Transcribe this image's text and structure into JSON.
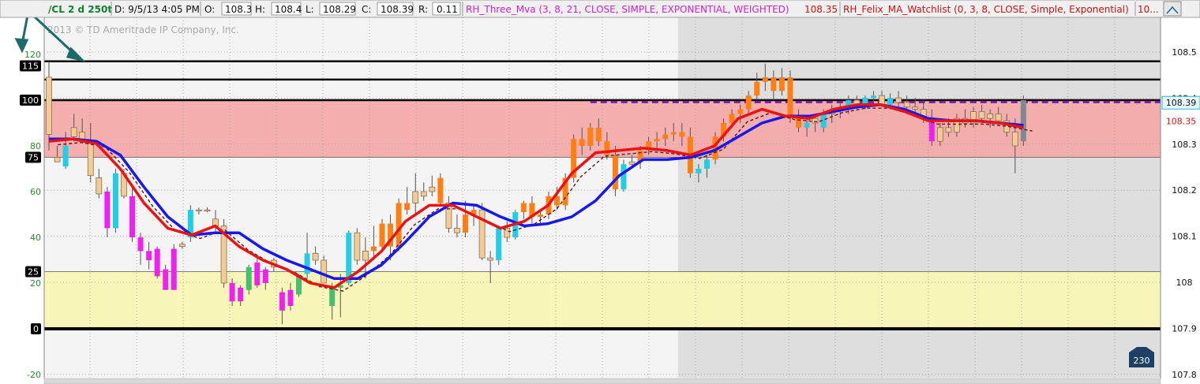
{
  "header": {
    "symbol": "/CL 2 d 250t",
    "date_field": "D: 9/5/13 4:05 PM",
    "open_label": "O:",
    "open_value": "108.3",
    "high_label": "H:",
    "high_value": "108.4",
    "low_label": "L:",
    "low_value": "108.29",
    "close_label": "C:",
    "close_value": "108.39",
    "range_label": "R:",
    "range_value": "0.11",
    "study1_name": "RH_Three_Mva (3, 8, 21, CLOSE, SIMPLE, EXPONENTIAL, WEIGHTED)",
    "study1_value": "108.35",
    "study2_name": "RH_Felix_MA_Watchlist (0, 3, 8, CLOSE, Simple, Exponential)",
    "study2_value": "10..."
  },
  "copyright": "2013 © TD Ameritrade IP Company, Inc.",
  "badge": "230",
  "colors": {
    "background": "#f4f4f4",
    "shaded_region": "#dedede",
    "red_zone": "#f4a8a8",
    "yellow_zone": "#f8f6b4",
    "candle_orange": "#ff7f14",
    "candle_cyan": "#22cde6",
    "candle_magenta": "#ee22ee",
    "candle_green": "#46c070",
    "candle_tan": "#f2cc96",
    "fast_ma": "#ee1111",
    "slow_ma_up": "#1818ee",
    "slow_ma_down": "#7a1aa6",
    "header_symbol": "#108030",
    "study1": "#cc22cc",
    "study2": "#cc1111"
  },
  "chart_data": {
    "type": "candlestick",
    "left_axis": {
      "ticks": [
        "-20",
        "0",
        "20",
        "25",
        "40",
        "60",
        "75",
        "80",
        "100",
        "115",
        "120"
      ],
      "range": [
        -20,
        125
      ],
      "boxed_ticks": [
        "0",
        "25",
        "75",
        "100",
        "115"
      ]
    },
    "right_axis": {
      "ticks": [
        "107.8",
        "107.9",
        "108",
        "108.1",
        "108.2",
        "108.3",
        "108.4",
        "108.5"
      ],
      "range": [
        107.795,
        108.555
      ]
    },
    "price_tags": [
      {
        "label": "108.39",
        "value": 108.39,
        "style": "cyan"
      },
      {
        "label": "108.35",
        "value": 108.35,
        "style": "red"
      }
    ],
    "horizontal_levels": [
      {
        "name": "level-0",
        "value": 0
      },
      {
        "name": "level-100",
        "value": 100
      },
      {
        "name": "level-upper-1",
        "value": 109
      },
      {
        "name": "level-upper-2",
        "value": 117
      }
    ],
    "zones": [
      {
        "name": "overbought-zone",
        "from": 75,
        "to": 100,
        "color": "red_zone"
      },
      {
        "name": "oversold-zone",
        "from": 0,
        "to": 25,
        "color": "yellow_zone"
      }
    ],
    "dashed_level": {
      "value": 99.2,
      "start_index": 65
    },
    "shaded_from_index": 76,
    "candles": [
      {
        "o": 110,
        "h": 117,
        "l": 78,
        "c": 85,
        "k": "tan"
      },
      {
        "o": 75,
        "h": 80,
        "l": 73,
        "c": 73,
        "k": "tan"
      },
      {
        "o": 80,
        "h": 86,
        "l": 70,
        "c": 71,
        "k": "cyan"
      },
      {
        "o": 88,
        "h": 94,
        "l": 82,
        "c": 84,
        "k": "tan"
      },
      {
        "o": 86,
        "h": 92,
        "l": 82,
        "c": 82,
        "k": "tan"
      },
      {
        "o": 81,
        "h": 90,
        "l": 64,
        "c": 67,
        "k": "tan"
      },
      {
        "o": 66,
        "h": 70,
        "l": 57,
        "c": 59,
        "k": "tan"
      },
      {
        "o": 60,
        "h": 62,
        "l": 40,
        "c": 44,
        "k": "magenta"
      },
      {
        "o": 44,
        "h": 70,
        "l": 42,
        "c": 68,
        "k": "cyan"
      },
      {
        "o": 68,
        "h": 70,
        "l": 57,
        "c": 58,
        "k": "tan"
      },
      {
        "o": 58,
        "h": 62,
        "l": 38,
        "c": 40,
        "k": "magenta"
      },
      {
        "o": 40,
        "h": 42,
        "l": 28,
        "c": 34,
        "k": "magenta"
      },
      {
        "o": 34,
        "h": 38,
        "l": 26,
        "c": 30,
        "k": "magenta"
      },
      {
        "o": 35,
        "h": 36,
        "l": 22,
        "c": 23,
        "k": "magenta"
      },
      {
        "o": 26,
        "h": 28,
        "l": 17,
        "c": 17,
        "k": "magenta"
      },
      {
        "o": 35,
        "h": 37,
        "l": 17,
        "c": 17,
        "k": "magenta"
      },
      {
        "o": 36,
        "h": 38,
        "l": 35,
        "c": 37,
        "k": "tan"
      },
      {
        "o": 40,
        "h": 54,
        "l": 38,
        "c": 52,
        "k": "cyan"
      },
      {
        "o": 52,
        "h": 53,
        "l": 50,
        "c": 52,
        "k": "tan"
      },
      {
        "o": 52,
        "h": 53,
        "l": 51,
        "c": 52,
        "k": "tan"
      },
      {
        "o": 48,
        "h": 52,
        "l": 42,
        "c": 45,
        "k": "tan"
      },
      {
        "o": 45,
        "h": 48,
        "l": 18,
        "c": 20,
        "k": "tan"
      },
      {
        "o": 20,
        "h": 22,
        "l": 10,
        "c": 12,
        "k": "magenta"
      },
      {
        "o": 18,
        "h": 19,
        "l": 10,
        "c": 12,
        "k": "magenta"
      },
      {
        "o": 17,
        "h": 28,
        "l": 15,
        "c": 27,
        "k": "green"
      },
      {
        "o": 19,
        "h": 31,
        "l": 18,
        "c": 29,
        "k": "magenta"
      },
      {
        "o": 20,
        "h": 27,
        "l": 17,
        "c": 26,
        "k": "magenta"
      },
      {
        "o": 30,
        "h": 31,
        "l": 25,
        "c": 27,
        "k": "tan"
      },
      {
        "o": 16,
        "h": 18,
        "l": 2,
        "c": 8,
        "k": "magenta"
      },
      {
        "o": 17,
        "h": 20,
        "l": 8,
        "c": 10,
        "k": "magenta"
      },
      {
        "o": 15,
        "h": 24,
        "l": 14,
        "c": 23,
        "k": "green"
      },
      {
        "o": 24,
        "h": 42,
        "l": 22,
        "c": 33,
        "k": "cyan"
      },
      {
        "o": 33,
        "h": 36,
        "l": 28,
        "c": 30,
        "k": "tan"
      },
      {
        "o": 30,
        "h": 32,
        "l": 24,
        "c": 20,
        "k": "tan"
      },
      {
        "o": 10,
        "h": 20,
        "l": 4,
        "c": 18,
        "k": "green"
      },
      {
        "o": 18,
        "h": 24,
        "l": 5,
        "c": 19,
        "k": "green"
      },
      {
        "o": 20,
        "h": 43,
        "l": 19,
        "c": 42,
        "k": "cyan"
      },
      {
        "o": 42,
        "h": 44,
        "l": 28,
        "c": 30,
        "k": "tan"
      },
      {
        "o": 30,
        "h": 40,
        "l": 22,
        "c": 34,
        "k": "tan"
      },
      {
        "o": 34,
        "h": 45,
        "l": 30,
        "c": 36,
        "k": "orange"
      },
      {
        "o": 36,
        "h": 48,
        "l": 34,
        "c": 46,
        "k": "orange"
      },
      {
        "o": 46,
        "h": 50,
        "l": 30,
        "c": 36,
        "k": "orange"
      },
      {
        "o": 36,
        "h": 57,
        "l": 34,
        "c": 55,
        "k": "orange"
      },
      {
        "o": 55,
        "h": 62,
        "l": 50,
        "c": 52,
        "k": "orange"
      },
      {
        "o": 55,
        "h": 68,
        "l": 50,
        "c": 60,
        "k": "tan"
      },
      {
        "o": 60,
        "h": 64,
        "l": 56,
        "c": 58,
        "k": "tan"
      },
      {
        "o": 62,
        "h": 67,
        "l": 58,
        "c": 60,
        "k": "tan"
      },
      {
        "o": 66,
        "h": 68,
        "l": 54,
        "c": 55,
        "k": "orange"
      },
      {
        "o": 55,
        "h": 58,
        "l": 42,
        "c": 44,
        "k": "tan"
      },
      {
        "o": 44,
        "h": 50,
        "l": 40,
        "c": 42,
        "k": "tan"
      },
      {
        "o": 42,
        "h": 56,
        "l": 40,
        "c": 50,
        "k": "orange"
      },
      {
        "o": 50,
        "h": 54,
        "l": 45,
        "c": 52,
        "k": "orange"
      },
      {
        "o": 52,
        "h": 55,
        "l": 30,
        "c": 31,
        "k": "tan"
      },
      {
        "o": 31,
        "h": 34,
        "l": 20,
        "c": 30,
        "k": "tan"
      },
      {
        "o": 30,
        "h": 45,
        "l": 28,
        "c": 44,
        "k": "cyan"
      },
      {
        "o": 44,
        "h": 47,
        "l": 38,
        "c": 40,
        "k": "tan"
      },
      {
        "o": 40,
        "h": 52,
        "l": 39,
        "c": 51,
        "k": "cyan"
      },
      {
        "o": 51,
        "h": 56,
        "l": 48,
        "c": 55,
        "k": "orange"
      },
      {
        "o": 55,
        "h": 58,
        "l": 46,
        "c": 49,
        "k": "orange"
      },
      {
        "o": 49,
        "h": 52,
        "l": 45,
        "c": 50,
        "k": "orange"
      },
      {
        "o": 50,
        "h": 60,
        "l": 48,
        "c": 58,
        "k": "orange"
      },
      {
        "o": 58,
        "h": 62,
        "l": 52,
        "c": 54,
        "k": "orange"
      },
      {
        "o": 54,
        "h": 68,
        "l": 52,
        "c": 66,
        "k": "orange"
      },
      {
        "o": 66,
        "h": 85,
        "l": 64,
        "c": 83,
        "k": "orange"
      },
      {
        "o": 83,
        "h": 88,
        "l": 76,
        "c": 80,
        "k": "orange"
      },
      {
        "o": 80,
        "h": 90,
        "l": 78,
        "c": 88,
        "k": "orange"
      },
      {
        "o": 88,
        "h": 92,
        "l": 80,
        "c": 82,
        "k": "orange"
      },
      {
        "o": 82,
        "h": 86,
        "l": 74,
        "c": 76,
        "k": "orange"
      },
      {
        "o": 76,
        "h": 80,
        "l": 58,
        "c": 61,
        "k": "orange"
      },
      {
        "o": 61,
        "h": 74,
        "l": 60,
        "c": 72,
        "k": "cyan"
      },
      {
        "o": 72,
        "h": 76,
        "l": 70,
        "c": 73,
        "k": "tan"
      },
      {
        "o": 73,
        "h": 80,
        "l": 70,
        "c": 78,
        "k": "orange"
      },
      {
        "o": 78,
        "h": 84,
        "l": 76,
        "c": 82,
        "k": "orange"
      },
      {
        "o": 82,
        "h": 86,
        "l": 78,
        "c": 83,
        "k": "orange"
      },
      {
        "o": 83,
        "h": 88,
        "l": 80,
        "c": 85,
        "k": "orange"
      },
      {
        "o": 85,
        "h": 90,
        "l": 82,
        "c": 86,
        "k": "orange"
      },
      {
        "o": 86,
        "h": 90,
        "l": 80,
        "c": 84,
        "k": "orange"
      },
      {
        "o": 84,
        "h": 88,
        "l": 66,
        "c": 68,
        "k": "orange"
      },
      {
        "o": 68,
        "h": 72,
        "l": 64,
        "c": 70,
        "k": "cyan"
      },
      {
        "o": 70,
        "h": 76,
        "l": 66,
        "c": 74,
        "k": "cyan"
      },
      {
        "o": 74,
        "h": 86,
        "l": 72,
        "c": 84,
        "k": "orange"
      },
      {
        "o": 84,
        "h": 92,
        "l": 82,
        "c": 90,
        "k": "orange"
      },
      {
        "o": 90,
        "h": 96,
        "l": 88,
        "c": 94,
        "k": "orange"
      },
      {
        "o": 94,
        "h": 98,
        "l": 90,
        "c": 96,
        "k": "orange"
      },
      {
        "o": 96,
        "h": 104,
        "l": 94,
        "c": 102,
        "k": "orange"
      },
      {
        "o": 102,
        "h": 112,
        "l": 100,
        "c": 108,
        "k": "orange"
      },
      {
        "o": 108,
        "h": 116,
        "l": 104,
        "c": 110,
        "k": "orange"
      },
      {
        "o": 110,
        "h": 113,
        "l": 100,
        "c": 104,
        "k": "orange"
      },
      {
        "o": 104,
        "h": 114,
        "l": 102,
        "c": 110,
        "k": "orange"
      },
      {
        "o": 110,
        "h": 113,
        "l": 90,
        "c": 92,
        "k": "orange"
      },
      {
        "o": 92,
        "h": 96,
        "l": 86,
        "c": 88,
        "k": "orange"
      },
      {
        "o": 88,
        "h": 92,
        "l": 84,
        "c": 90,
        "k": "cyan"
      },
      {
        "o": 90,
        "h": 94,
        "l": 86,
        "c": 92,
        "k": "tan"
      },
      {
        "o": 88,
        "h": 96,
        "l": 86,
        "c": 94,
        "k": "cyan"
      },
      {
        "o": 94,
        "h": 98,
        "l": 90,
        "c": 95,
        "k": "tan"
      },
      {
        "o": 95,
        "h": 99,
        "l": 92,
        "c": 97,
        "k": "cyan"
      },
      {
        "o": 97,
        "h": 102,
        "l": 94,
        "c": 100,
        "k": "cyan"
      },
      {
        "o": 100,
        "h": 102,
        "l": 96,
        "c": 97,
        "k": "tan"
      },
      {
        "o": 97,
        "h": 102,
        "l": 96,
        "c": 101,
        "k": "cyan"
      },
      {
        "o": 101,
        "h": 104,
        "l": 98,
        "c": 102,
        "k": "cyan"
      },
      {
        "o": 102,
        "h": 104,
        "l": 97,
        "c": 98,
        "k": "tan"
      },
      {
        "o": 98,
        "h": 103,
        "l": 96,
        "c": 101,
        "k": "cyan"
      },
      {
        "o": 101,
        "h": 104,
        "l": 97,
        "c": 99,
        "k": "tan"
      },
      {
        "o": 99,
        "h": 102,
        "l": 96,
        "c": 97,
        "k": "tan"
      },
      {
        "o": 97,
        "h": 101,
        "l": 94,
        "c": 96,
        "k": "tan"
      },
      {
        "o": 96,
        "h": 100,
        "l": 90,
        "c": 92,
        "k": "tan"
      },
      {
        "o": 92,
        "h": 96,
        "l": 80,
        "c": 82,
        "k": "magenta"
      },
      {
        "o": 82,
        "h": 90,
        "l": 80,
        "c": 88,
        "k": "tan"
      },
      {
        "o": 88,
        "h": 92,
        "l": 84,
        "c": 86,
        "k": "tan"
      },
      {
        "o": 86,
        "h": 94,
        "l": 84,
        "c": 92,
        "k": "tan"
      },
      {
        "o": 92,
        "h": 96,
        "l": 88,
        "c": 90,
        "k": "tan"
      },
      {
        "o": 90,
        "h": 97,
        "l": 88,
        "c": 95,
        "k": "tan"
      },
      {
        "o": 95,
        "h": 98,
        "l": 90,
        "c": 92,
        "k": "tan"
      },
      {
        "o": 92,
        "h": 96,
        "l": 88,
        "c": 94,
        "k": "tan"
      },
      {
        "o": 94,
        "h": 97,
        "l": 90,
        "c": 91,
        "k": "tan"
      },
      {
        "o": 91,
        "h": 94,
        "l": 84,
        "c": 86,
        "k": "tan"
      },
      {
        "o": 86,
        "h": 92,
        "l": 68,
        "c": 80,
        "k": "tan"
      },
      {
        "o": 82,
        "h": 102,
        "l": 80,
        "c": 100,
        "k": "gray"
      }
    ],
    "ma_fast": [
      [
        0,
        82
      ],
      [
        4,
        83
      ],
      [
        8,
        81
      ],
      [
        12,
        70
      ],
      [
        16,
        55
      ],
      [
        20,
        44
      ],
      [
        24,
        41
      ],
      [
        28,
        45
      ],
      [
        32,
        36
      ],
      [
        36,
        30
      ],
      [
        40,
        26
      ],
      [
        44,
        20
      ],
      [
        48,
        18
      ],
      [
        52,
        25
      ],
      [
        56,
        34
      ],
      [
        60,
        47
      ],
      [
        64,
        54
      ],
      [
        68,
        54
      ],
      [
        72,
        49
      ],
      [
        76,
        44
      ],
      [
        80,
        47
      ],
      [
        84,
        54
      ],
      [
        88,
        68
      ],
      [
        92,
        77
      ],
      [
        96,
        78
      ],
      [
        100,
        79
      ],
      [
        104,
        78
      ],
      [
        108,
        76
      ],
      [
        112,
        80
      ],
      [
        116,
        92
      ],
      [
        120,
        96
      ],
      [
        124,
        93
      ],
      [
        128,
        92
      ],
      [
        132,
        96
      ],
      [
        136,
        98
      ],
      [
        140,
        98
      ],
      [
        144,
        95
      ],
      [
        148,
        91
      ],
      [
        152,
        91
      ],
      [
        156,
        91
      ],
      [
        160,
        90
      ],
      [
        164,
        88
      ]
    ],
    "ma_slow": [
      [
        0,
        83
      ],
      [
        4,
        83
      ],
      [
        8,
        82
      ],
      [
        12,
        76
      ],
      [
        16,
        62
      ],
      [
        20,
        49
      ],
      [
        24,
        41
      ],
      [
        28,
        42
      ],
      [
        32,
        42
      ],
      [
        36,
        35
      ],
      [
        40,
        30
      ],
      [
        44,
        26
      ],
      [
        48,
        22
      ],
      [
        52,
        22
      ],
      [
        56,
        28
      ],
      [
        60,
        38
      ],
      [
        64,
        49
      ],
      [
        68,
        55
      ],
      [
        72,
        54
      ],
      [
        76,
        49
      ],
      [
        80,
        45
      ],
      [
        84,
        46
      ],
      [
        88,
        49
      ],
      [
        92,
        56
      ],
      [
        96,
        67
      ],
      [
        100,
        74
      ],
      [
        104,
        74
      ],
      [
        108,
        75
      ],
      [
        112,
        78
      ],
      [
        116,
        84
      ],
      [
        120,
        90
      ],
      [
        124,
        93
      ],
      [
        128,
        93
      ],
      [
        132,
        95
      ],
      [
        136,
        97
      ],
      [
        140,
        98
      ],
      [
        144,
        96
      ],
      [
        148,
        92
      ],
      [
        152,
        91
      ],
      [
        156,
        91
      ],
      [
        160,
        90
      ],
      [
        164,
        89
      ]
    ]
  }
}
